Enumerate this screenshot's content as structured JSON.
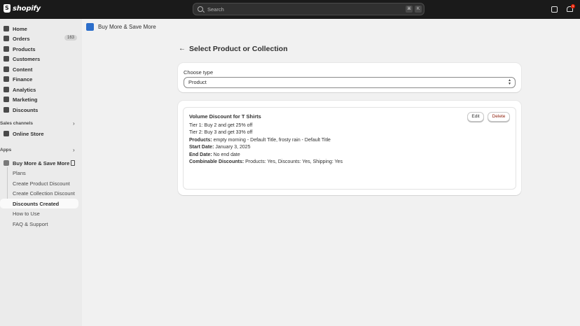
{
  "topbar": {
    "brand": "shopify",
    "search_placeholder": "Search",
    "shortcut_keys": [
      "⌘",
      "K"
    ],
    "notification_count": "1"
  },
  "sidebar": {
    "items": [
      {
        "label": "Home",
        "icon": "home-icon"
      },
      {
        "label": "Orders",
        "icon": "orders-icon",
        "badge": "163"
      },
      {
        "label": "Products",
        "icon": "tag-icon"
      },
      {
        "label": "Customers",
        "icon": "person-icon"
      },
      {
        "label": "Content",
        "icon": "content-icon"
      },
      {
        "label": "Finance",
        "icon": "bank-icon"
      },
      {
        "label": "Analytics",
        "icon": "chart-icon"
      },
      {
        "label": "Marketing",
        "icon": "target-icon"
      },
      {
        "label": "Discounts",
        "icon": "discount-icon"
      }
    ],
    "sales_channels_heading": "Sales channels",
    "online_store": "Online Store",
    "apps_heading": "Apps",
    "app_name": "Buy More & Save More",
    "app_subitems": [
      {
        "label": "Plans",
        "active": false
      },
      {
        "label": "Create Product Discount",
        "active": false
      },
      {
        "label": "Create Collection Discount",
        "active": false
      },
      {
        "label": "Discounts Created",
        "active": true
      },
      {
        "label": "How to Use",
        "active": false
      },
      {
        "label": "FAQ & Support",
        "active": false
      }
    ]
  },
  "main": {
    "app_title": "Buy More & Save More",
    "page_title": "Select Product or Collection",
    "choose_type_label": "Choose type",
    "choose_type_value": "Product",
    "discount": {
      "title": "Volume Discount for T Shirts",
      "tier1": "Tier 1: Buy 2 and get 25% off",
      "tier2": "Tier 2: Buy 3 and get 33% off",
      "products_label": "Products:",
      "products_value": " empty morning - Default Title, frosty rain - Default Title",
      "start_label": "Start Date:",
      "start_value": " January 3, 2025",
      "end_label": "End Date:",
      "end_value": " No end date",
      "combinable_label": "Combinable Discounts:",
      "combinable_value": " Products: Yes, Discounts: Yes, Shipping: Yes",
      "edit_label": "Edit",
      "delete_label": "Delete"
    }
  },
  "colors": {
    "topbar_bg": "#1a1a1a",
    "sidebar_bg": "#ebebeb",
    "main_bg": "#f1f1f1",
    "card_bg": "#ffffff",
    "delete_text": "#8e1f0b",
    "badge_red": "#e51c00"
  }
}
